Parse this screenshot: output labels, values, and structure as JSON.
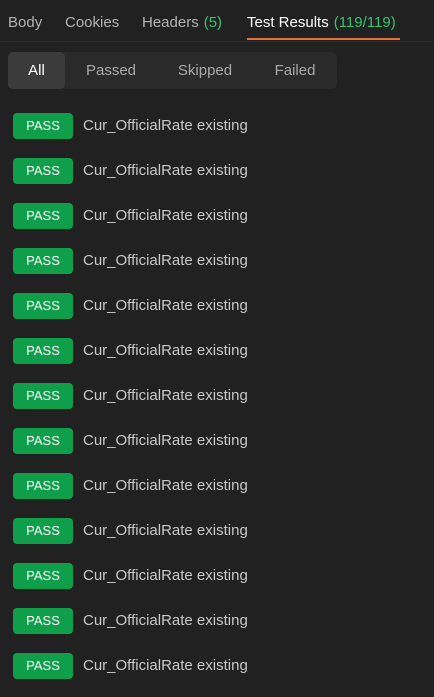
{
  "tabs": [
    {
      "label": "Body",
      "count": ""
    },
    {
      "label": "Cookies",
      "count": ""
    },
    {
      "label": "Headers",
      "count": "(5)"
    },
    {
      "label": "Test Results",
      "count": "(119/119)"
    }
  ],
  "active_tab": "Test Results",
  "filters": [
    "All",
    "Passed",
    "Skipped",
    "Failed"
  ],
  "active_filter": "All",
  "results": [
    {
      "status": "PASS",
      "name": "Cur_OfficialRate existing"
    },
    {
      "status": "PASS",
      "name": "Cur_OfficialRate existing"
    },
    {
      "status": "PASS",
      "name": "Cur_OfficialRate existing"
    },
    {
      "status": "PASS",
      "name": "Cur_OfficialRate existing"
    },
    {
      "status": "PASS",
      "name": "Cur_OfficialRate existing"
    },
    {
      "status": "PASS",
      "name": "Cur_OfficialRate existing"
    },
    {
      "status": "PASS",
      "name": "Cur_OfficialRate existing"
    },
    {
      "status": "PASS",
      "name": "Cur_OfficialRate existing"
    },
    {
      "status": "PASS",
      "name": "Cur_OfficialRate existing"
    },
    {
      "status": "PASS",
      "name": "Cur_OfficialRate existing"
    },
    {
      "status": "PASS",
      "name": "Cur_OfficialRate existing"
    },
    {
      "status": "PASS",
      "name": "Cur_OfficialRate existing"
    },
    {
      "status": "PASS",
      "name": "Cur_OfficialRate existing"
    }
  ],
  "colors": {
    "background": "#212121",
    "accent_underline": "#f26b3a",
    "count_green": "#39c26d",
    "pass_badge": "#0f9f4a"
  }
}
